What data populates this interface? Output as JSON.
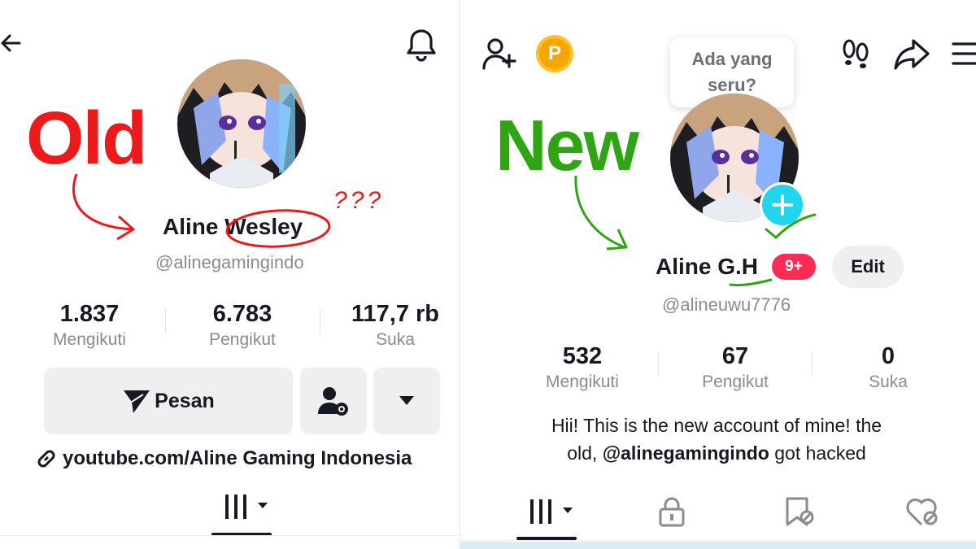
{
  "old_panel": {
    "annotation_label": "Old",
    "annotation_question": "???",
    "display_name_first": "Aline",
    "display_name_last": "Wesley",
    "username": "@alinegamingindo",
    "stats": [
      {
        "value": "1.837",
        "label": "Mengikuti"
      },
      {
        "value": "6.783",
        "label": "Pengikut"
      },
      {
        "value": "117,7 rb",
        "label": "Suka"
      }
    ],
    "message_button_label": "Pesan",
    "bio_link": "youtube.com/Aline Gaming Indonesia",
    "icons": [
      "back-arrow-icon",
      "bell-icon",
      "send-icon",
      "user-settings-icon",
      "caret-down-icon",
      "link-icon",
      "grid-icon"
    ]
  },
  "new_panel": {
    "annotation_label": "New",
    "tooltip_text": "Ada yang seru?",
    "display_name_first": "Aline",
    "display_name_last": "G.H",
    "notification_badge": "9+",
    "edit_button_label": "Edit",
    "username": "@alineuwu7776",
    "stats": [
      {
        "value": "532",
        "label": "Mengikuti"
      },
      {
        "value": "67",
        "label": "Pengikut"
      },
      {
        "value": "0",
        "label": "Suka"
      }
    ],
    "bio_line1": "Hii! This is the new account of mine! the",
    "bio_line2_prefix": "old,",
    "bio_mention": "@alinegamingindo",
    "bio_line2_suffix": "got hacked",
    "coin_letter": "P",
    "icons": [
      "add-friend-icon",
      "coin-icon",
      "footprints-icon",
      "share-icon",
      "menu-icon",
      "plus-icon",
      "grid-icon",
      "lock-icon",
      "bookmark-icon",
      "heart-icon"
    ]
  },
  "colors": {
    "old_annotation": "#ec1b1b",
    "new_annotation": "#2fa515",
    "badge": "#fe2c55",
    "add_button": "#20d5ec",
    "coin": "#f7a600"
  }
}
